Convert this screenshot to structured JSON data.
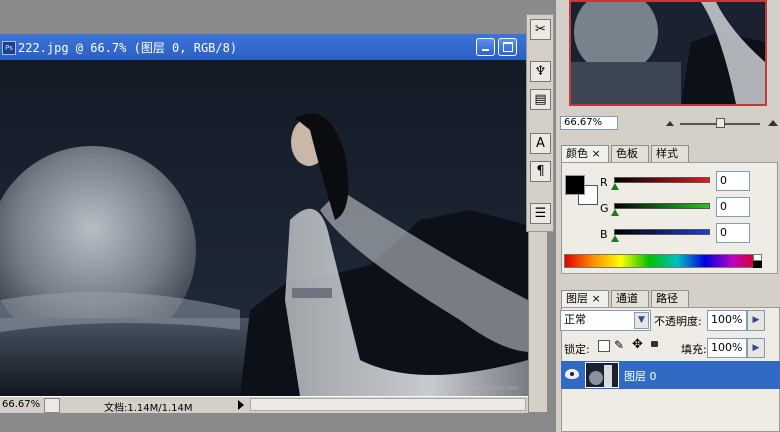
{
  "document": {
    "title": "222.jpg @ 66.7% (图层 0, RGB/8)",
    "app_icon": "Ps",
    "zoom": "66.67%",
    "doc_info": "文档:1.14M/1.14M",
    "watermark": "www.21cnxx.com"
  },
  "navigator": {
    "zoom": "66.67%"
  },
  "color_panel": {
    "tabs": [
      "颜色",
      "色板",
      "样式"
    ],
    "channels": [
      {
        "label": "R",
        "value": "0",
        "color": "#c81e1e"
      },
      {
        "label": "G",
        "value": "0",
        "color": "#1fb41f"
      },
      {
        "label": "B",
        "value": "0",
        "color": "#1e3cc8"
      }
    ],
    "foreground": "#000000",
    "background": "#ffffff"
  },
  "layers_panel": {
    "tabs": [
      "图层",
      "通道",
      "路径"
    ],
    "blend_mode": "正常",
    "opacity_label": "不透明度:",
    "opacity": "100%",
    "lock_label": "锁定:",
    "fill_label": "填充:",
    "fill": "100%",
    "layers": [
      {
        "name": "图层 0",
        "visible": true,
        "selected": true
      }
    ]
  },
  "icons": [
    "app-icon",
    "minimize-icon",
    "maximize-icon",
    "crop-tool-icon",
    "stamp-tool-icon",
    "history-brush-icon",
    "type-tool-icon",
    "paragraph-icon",
    "notes-icon",
    "eye-icon",
    "lock-icon",
    "link-icon",
    "move-icon",
    "brush-icon"
  ],
  "colors": {
    "title_bar": "#2a5fc4",
    "selected_layer": "#316ac5",
    "nav_frame": "#c03a3a"
  }
}
